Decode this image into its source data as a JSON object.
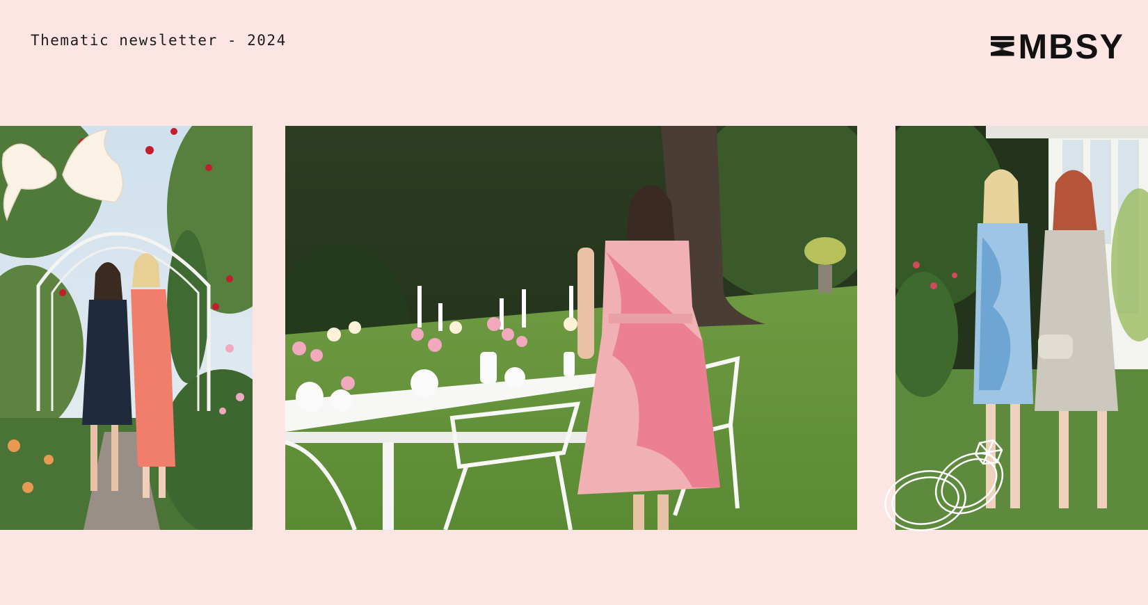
{
  "header": {
    "title": "Thematic newsletter - 2024"
  },
  "brand": {
    "logo_text": "MBSY",
    "logo_mark_icon": "stacked-chevron-m-icon"
  },
  "photos": [
    {
      "id": "left",
      "subject": "two women in dresses under a rose arch",
      "decor_icon": "doves-icon"
    },
    {
      "id": "center",
      "subject": "woman in pink floral dress beside a set garden table",
      "decor_icon": ""
    },
    {
      "id": "right",
      "subject": "two women in blue and silver dresses by a garden house",
      "decor_icon": "wedding-rings-icon"
    }
  ],
  "colors": {
    "background": "#fde5e4",
    "text": "#1b1b1b"
  }
}
